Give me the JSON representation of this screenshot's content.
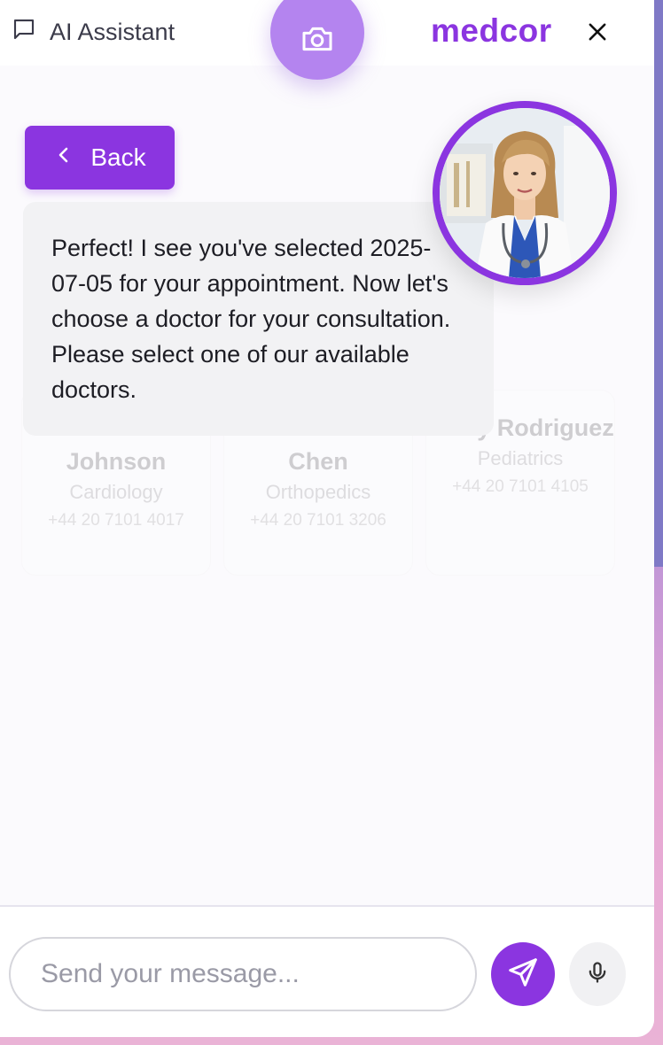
{
  "header": {
    "assistant_label": "AI Assistant",
    "brand": "medcor"
  },
  "navigation": {
    "back_label": "Back"
  },
  "message": {
    "text": "Perfect! I see you've selected 2025-07-05 for your appointment. Now let's choose a doctor for your consultation. Please select one of our available doctors."
  },
  "doctor_cards": [
    {
      "name": "Johnson",
      "specialty": "Cardiology",
      "phone": "+44 20 7101 4017"
    },
    {
      "name": "Chen",
      "specialty": "Orthopedics",
      "phone": "+44 20 7101 3206"
    },
    {
      "name": "Emily Rodriguez",
      "specialty": "Pediatrics",
      "phone": "+44 20 7101 4105"
    }
  ],
  "composer": {
    "placeholder": "Send your message..."
  },
  "colors": {
    "accent": "#8b35e0",
    "camera": "#b484ef"
  },
  "icons": {
    "chat": "chat-bubble-icon",
    "camera": "camera-icon",
    "close": "close-icon",
    "back": "chevron-left-icon",
    "send": "send-icon",
    "mic": "microphone-icon"
  }
}
